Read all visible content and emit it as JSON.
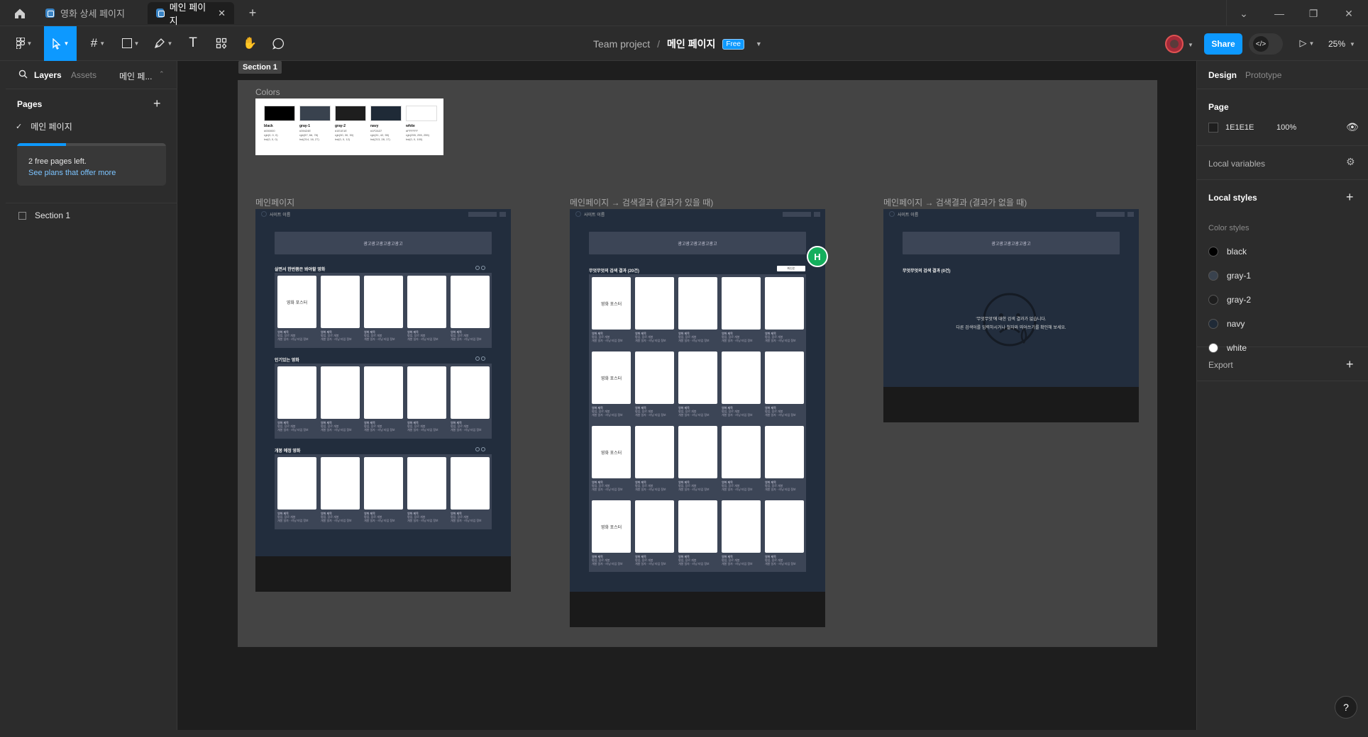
{
  "titlebar": {
    "tabs": [
      {
        "label": "영화 상세 페이지"
      },
      {
        "label": "메인 페이지"
      }
    ]
  },
  "toolbar": {
    "project": "Team project",
    "separator": "/",
    "page": "메인 페이지",
    "plan_badge": "Free",
    "share_label": "Share",
    "zoom": "25%"
  },
  "left_panel": {
    "tab_layers": "Layers",
    "tab_assets": "Assets",
    "page_switch": "메인 페...",
    "pages_title": "Pages",
    "pages": [
      {
        "label": "메인 페이지"
      }
    ],
    "free_text": "2 free pages left.",
    "free_link": "See plans that offer more",
    "free_progress": 0.33,
    "layers": [
      {
        "label": "Section 1"
      }
    ]
  },
  "canvas": {
    "section_label": "Section 1",
    "colors_label": "Colors",
    "palette": [
      {
        "name": "black",
        "hex": "#000000",
        "lines": [
          "#000000",
          "rgb(0, 0, 0)",
          "hsl(0, 0, 0)"
        ]
      },
      {
        "name": "gray-1",
        "hex": "#39424E",
        "lines": [
          "#39424E",
          "rgb(57, 66, 78)",
          "hsl(214, 16, 27)"
        ]
      },
      {
        "name": "gray-2",
        "hex": "#1E1E1E",
        "lines": [
          "#1E1E1E",
          "rgb(30, 30, 30)",
          "hsl(0, 0, 12)"
        ]
      },
      {
        "name": "navy",
        "hex": "#1F2A37",
        "lines": [
          "#1F2A37",
          "rgb(31, 42, 55)",
          "hsl(213, 28, 17)"
        ]
      },
      {
        "name": "white",
        "hex": "#FFFFFF",
        "lines": [
          "#FFFFFF",
          "rgb(255, 255, 255)",
          "hsl(0, 0, 100)"
        ]
      }
    ],
    "frames": [
      {
        "label": "메인페이지",
        "site_name": "사이트 이름",
        "banner": "광고광고광고광고광고",
        "rows": [
          {
            "title": "살면서 한번쯤은 봐야할 영화"
          },
          {
            "title": "인기있는 영화"
          },
          {
            "title": "개봉 예정 영화"
          }
        ],
        "poster_label": "영화 포스터",
        "card_title": "영화 제목",
        "card_meta1": "평점, 장르 개봉",
        "card_meta2": "개봉 일자 · 러닝 타임 정보"
      },
      {
        "label": "메인페이지 → 검색결과 (결과가 있을 때)",
        "site_name": "사이트 이름",
        "banner": "광고광고광고광고광고",
        "result_title": "무엇무엇의 검색 결과 (20건)",
        "sort_label": "최신순",
        "poster_label": "영화 포스터",
        "card_title": "영화 제목",
        "card_meta1": "평점, 장르 개봉",
        "card_meta2": "개봉 일자 · 러닝 타임 정보"
      },
      {
        "label": "메인페이지 → 검색결과 (결과가 없을 때)",
        "site_name": "사이트 이름",
        "banner": "광고광고광고광고광고",
        "result_title": "무엇무엇의 검색 결과 (0건)",
        "empty_line1": "'무엇무엇'에 대한 검색 결과가 없습니다.",
        "empty_line2": "다른 검색어를 입력하시거나 철자와 띄어쓰기를 확인해 보세요."
      }
    ],
    "cursor_initial": "H"
  },
  "right_panel": {
    "tab_design": "Design",
    "tab_prototype": "Prototype",
    "page_title": "Page",
    "page_color": "1E1E1E",
    "page_opacity": "100%",
    "local_variables": "Local variables",
    "local_styles": "Local styles",
    "color_styles": "Color styles",
    "styles": [
      {
        "name": "black",
        "color": "#000000"
      },
      {
        "name": "gray-1",
        "color": "#39424E"
      },
      {
        "name": "gray-2",
        "color": "#1E1E1E"
      },
      {
        "name": "navy",
        "color": "#1F2A37"
      },
      {
        "name": "white",
        "color": "#FFFFFF"
      }
    ],
    "export": "Export",
    "help": "?"
  },
  "colors": {
    "accent": "#0d99ff",
    "cursor": "#14ae5c"
  }
}
